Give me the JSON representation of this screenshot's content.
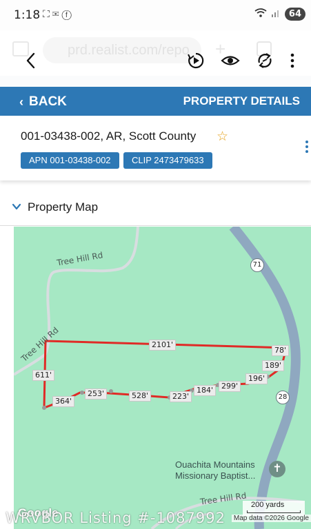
{
  "status_bar": {
    "time": "1:18",
    "icons": [
      "screenshot-icon",
      "mail-icon",
      "facebook-icon"
    ],
    "wifi": "wifi-icon",
    "battery": "64"
  },
  "browser": {
    "url_text": "prd.realist.com/repo",
    "toolbar_icons": [
      "back-arrow-icon",
      "play-icon",
      "eye-icon",
      "sync-icon",
      "more-vertical-icon"
    ]
  },
  "app_nav": {
    "back_label": "BACK",
    "title": "PROPERTY DETAILS",
    "color": "#2d78b5"
  },
  "property": {
    "title": "001-03438-002, AR, Scott County",
    "apn_chip": "APN 001-03438-002",
    "clip_chip": "CLIP 2473479633",
    "favorite_icon": "star-outline-icon"
  },
  "section": {
    "title": "Property Map"
  },
  "map": {
    "roads": [
      "Tree Hill Rd",
      "Tree Hill Rd",
      "Tree Hill Rd"
    ],
    "highways": [
      "71",
      "28"
    ],
    "boundary_lengths": [
      "2101'",
      "78'",
      "189'",
      "196'",
      "299'",
      "184'",
      "223'",
      "528'",
      "253'",
      "364'",
      "611'"
    ],
    "poi_line1": "Ouachita Mountains",
    "poi_line2": "Missionary Baptist...",
    "poi_icon": "church-icon",
    "scale": "200 yards",
    "logo": "Google",
    "attribution": "Map data ©2026 Google",
    "watermark": "WRVBOR Listing #-1087992",
    "boundary_color": "#e02a26",
    "highway_color": "#8fa8c0"
  }
}
